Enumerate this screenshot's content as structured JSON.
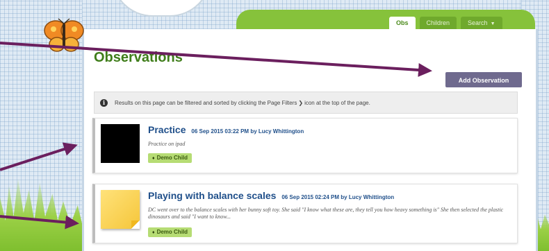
{
  "nav": {
    "tabs": [
      {
        "label": "Obs",
        "active": true
      },
      {
        "label": "Children"
      },
      {
        "label": "Search"
      }
    ]
  },
  "page": {
    "title": "Observations"
  },
  "toolbar": {
    "add_label": "Add Observation"
  },
  "info": {
    "text_before": "Results on this page can be filtered and sorted by clicking the Page Filters",
    "text_after": "icon at the top of the page."
  },
  "observations": [
    {
      "title": "Practice",
      "date": "06 Sep 2015 03:22 PM by",
      "author": "Lucy Whittington",
      "description": "Practice on ipad",
      "child": "Demo Child",
      "thumb": "black"
    },
    {
      "title": "Playing with balance scales",
      "date": "06 Sep 2015 02:24 PM by",
      "author": "Lucy Whittington",
      "description": "DC went over to the balance scales with her bunny soft toy. She said \"I know what these are, they tell you how heavy something is\" She then selected the plastic dinosaurs and said \"I want to know...",
      "child": "Demo Child",
      "thumb": "sticky-note"
    }
  ],
  "colors": {
    "title_green": "#3f7d1a",
    "link_blue": "#1f4f8a",
    "button_purple": "#6f6a8e",
    "annotation_arrow": "#6b1f5e"
  }
}
